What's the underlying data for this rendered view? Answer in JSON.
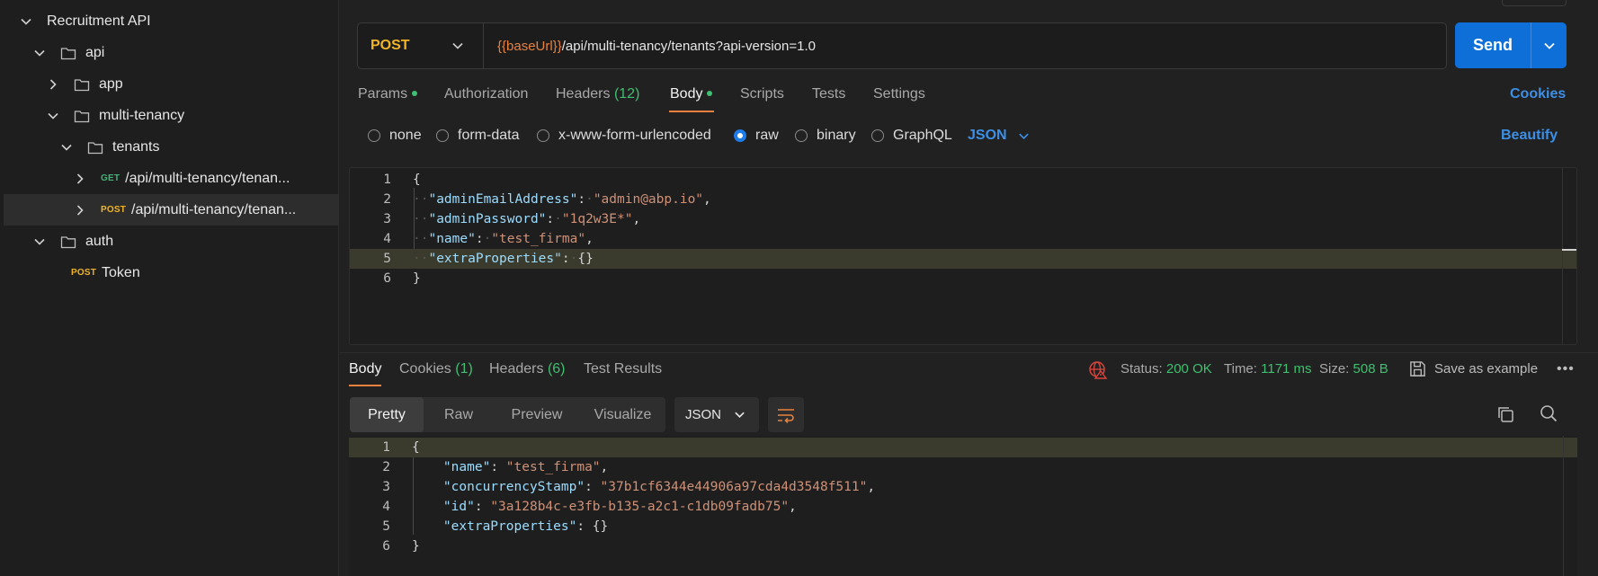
{
  "sidebar": {
    "collection": "Recruitment API",
    "folder_api": "api",
    "folder_app": "app",
    "folder_multi_tenancy": "multi-tenancy",
    "folder_tenants": "tenants",
    "req_get": {
      "method": "GET",
      "name": "/api/multi-tenancy/tenan..."
    },
    "req_post": {
      "method": "POST",
      "name": "/api/multi-tenancy/tenan..."
    },
    "folder_auth": "auth",
    "req_token": {
      "method": "POST",
      "name": "Token"
    }
  },
  "request": {
    "method": "POST",
    "url_variable": "{{baseUrl}}",
    "url_path": "/api/multi-tenancy/tenants?api-version=1.0",
    "send_label": "Send"
  },
  "req_tabs": {
    "params": "Params",
    "authorization": "Authorization",
    "headers": "Headers",
    "headers_count": "(12)",
    "body": "Body",
    "scripts": "Scripts",
    "tests": "Tests",
    "settings": "Settings",
    "cookies": "Cookies"
  },
  "body_types": {
    "none": "none",
    "form_data": "form-data",
    "urlencoded": "x-www-form-urlencoded",
    "raw": "raw",
    "binary": "binary",
    "graphql": "GraphQL",
    "format": "JSON",
    "beautify": "Beautify"
  },
  "request_body": {
    "l1": "{",
    "k2": "\"adminEmailAddress\"",
    "v2": "\"admin@abp.io\"",
    "k3": "\"adminPassword\"",
    "v3": "\"1q2w3E*\"",
    "k4": "\"name\"",
    "v4": "\"test_firma\"",
    "k5": "\"extraProperties\"",
    "v5": "{}",
    "l6": "}"
  },
  "resp_tabs": {
    "body": "Body",
    "cookies": "Cookies",
    "cookies_count": "(1)",
    "headers": "Headers",
    "headers_count": "(6)",
    "test_results": "Test Results"
  },
  "resp_meta": {
    "status_label": "Status:",
    "status_value": "200 OK",
    "time_label": "Time:",
    "time_value": "1171 ms",
    "size_label": "Size:",
    "size_value": "508 B",
    "save_example": "Save as example"
  },
  "resp_toolbar": {
    "pretty": "Pretty",
    "raw": "Raw",
    "preview": "Preview",
    "visualize": "Visualize",
    "format": "JSON"
  },
  "response_body": {
    "l1": "{",
    "k2": "\"name\"",
    "v2": "\"test_firma\"",
    "k3": "\"concurrencyStamp\"",
    "v3": "\"37b1cf6344e44906a97cda4d3548f511\"",
    "k4": "\"id\"",
    "v4": "\"3a128b4c-e3fb-b135-a2c1-c1db09fadb75\"",
    "k5": "\"extraProperties\"",
    "v5": "{}",
    "l6": "}"
  },
  "colors": {
    "accent": "#e8813d",
    "send": "#0e6fd8",
    "post": "#f0b429",
    "get": "#43b37a",
    "success": "#3fbf6f",
    "link": "#3d8fe5"
  }
}
